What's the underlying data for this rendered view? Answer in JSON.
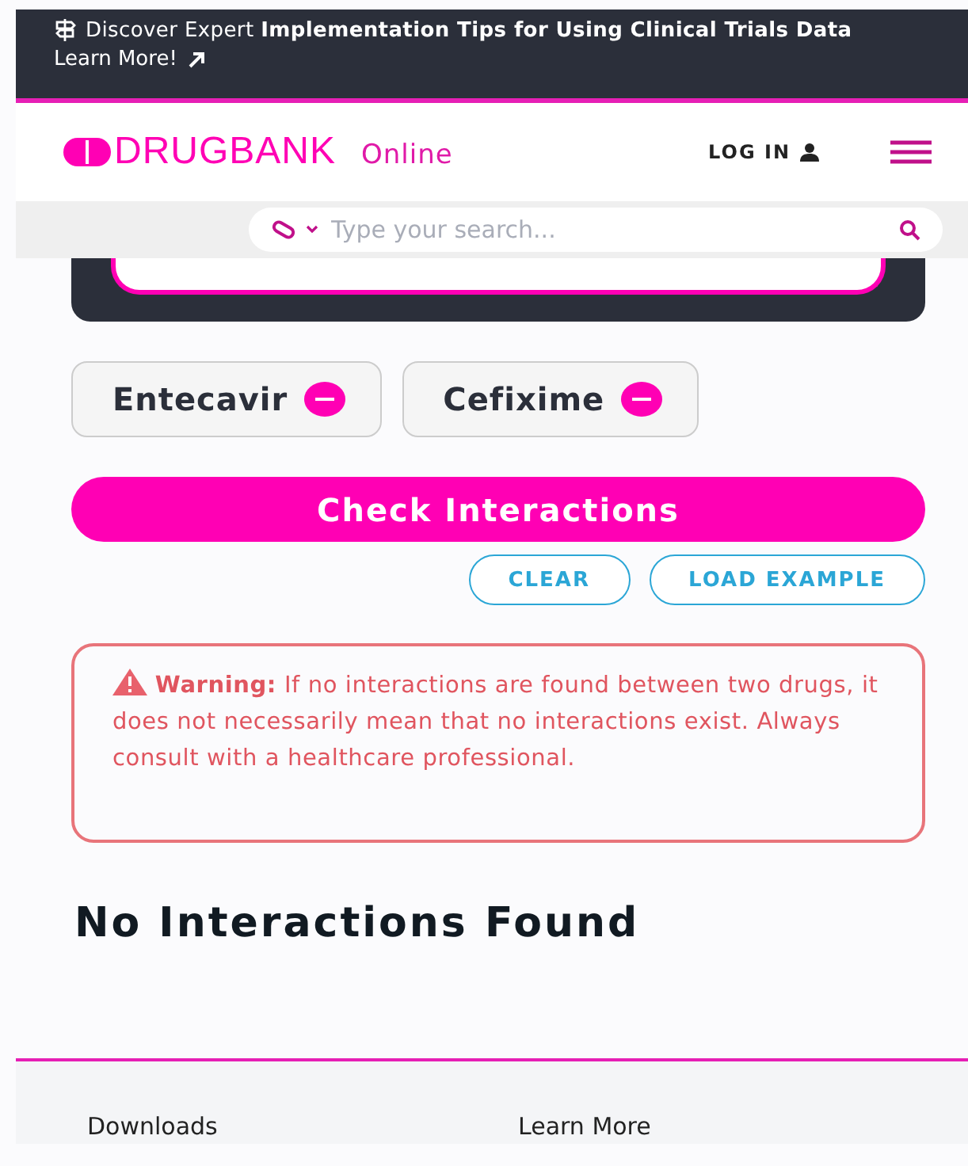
{
  "banner": {
    "text": "Discover Expert **Implementation Tips for Using Clinical Trials Data**",
    "link": "Learn More!"
  },
  "header": {
    "logo": "DRUGBANK",
    "logo_suffix": "Online",
    "login": "LOG IN"
  },
  "search": {
    "placeholder": "Type your search..."
  },
  "drugs": [
    {
      "name": "Entecavir"
    },
    {
      "name": "Cefixime"
    }
  ],
  "check_button": "Check Interactions",
  "actions": [
    "CLEAR",
    "LOAD EXAMPLE"
  ],
  "warning": {
    "label": "Warning:",
    "text": "If no interactions are found between two drugs, it does not necessarily mean that no interactions exist. Always consult with a healthcare professional."
  },
  "result_heading": "No Interactions Found",
  "footer": {
    "columns": [
      "Downloads",
      "Learn More"
    ]
  }
}
